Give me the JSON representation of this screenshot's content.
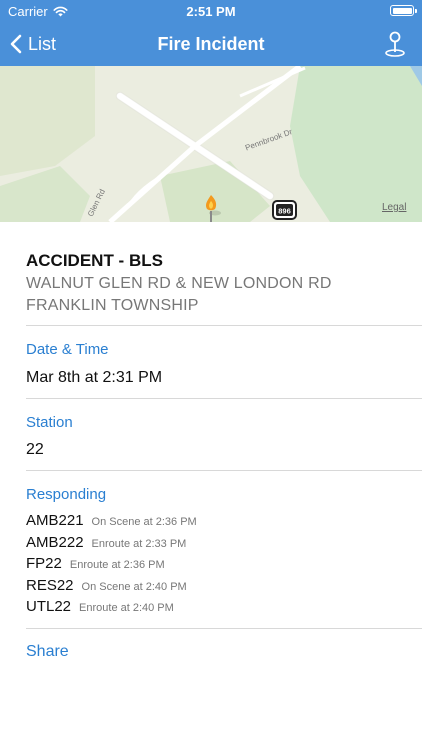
{
  "status_bar": {
    "carrier": "Carrier",
    "time": "2:51 PM"
  },
  "nav": {
    "back_label": "List",
    "title": "Fire Incident",
    "right_icon": "map-pin-icon"
  },
  "map": {
    "street_labels": [
      "Pennbrook Dr",
      "Glen Rd"
    ],
    "route_shield": "896",
    "legal": "Legal",
    "marker_icon": "fire-marker-icon"
  },
  "incident": {
    "type": "ACCIDENT - BLS",
    "address": "WALNUT GLEN RD & NEW LONDON RD",
    "township": "FRANKLIN TOWNSHIP"
  },
  "date_time": {
    "label": "Date & Time",
    "value": "Mar 8th at 2:31 PM"
  },
  "station": {
    "label": "Station",
    "value": "22"
  },
  "responding": {
    "label": "Responding",
    "units": [
      {
        "name": "AMB221",
        "status": "On Scene at 2:36 PM"
      },
      {
        "name": "AMB222",
        "status": "Enroute at 2:33 PM"
      },
      {
        "name": "FP22",
        "status": "Enroute at 2:36 PM"
      },
      {
        "name": "RES22",
        "status": "On Scene at 2:40 PM"
      },
      {
        "name": "UTL22",
        "status": "Enroute at 2:40 PM"
      }
    ]
  },
  "share": {
    "label": "Share"
  },
  "colors": {
    "header": "#4a90d9",
    "accent": "#2a7fd1",
    "secondary_text": "#777777"
  }
}
